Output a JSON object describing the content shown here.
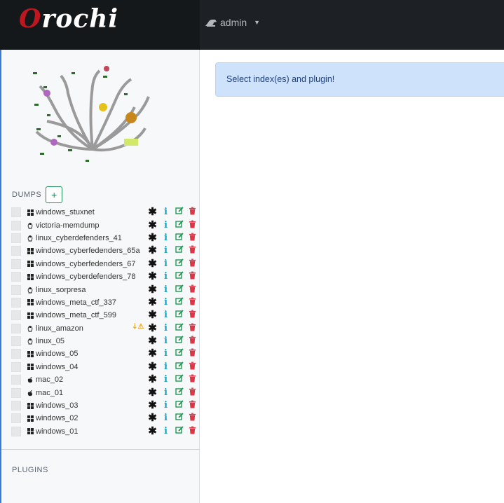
{
  "brand": {
    "first": "O",
    "rest": "rochi"
  },
  "user_menu": {
    "label": "admin",
    "icon": "user-icon"
  },
  "dumps": {
    "title": "DUMPS",
    "add_label": "+",
    "items": [
      {
        "name": "windows_stuxnet",
        "os": "windows"
      },
      {
        "name": "victoria-memdump",
        "os": "linux"
      },
      {
        "name": "linux_cyberdefenders_41",
        "os": "linux"
      },
      {
        "name": "windows_cyberfedenders_65a",
        "os": "windows"
      },
      {
        "name": "windows_cyberfedenders_67",
        "os": "windows"
      },
      {
        "name": "windows_cyberdefenders_78",
        "os": "windows"
      },
      {
        "name": "linux_sorpresa",
        "os": "linux"
      },
      {
        "name": "windows_meta_ctf_337",
        "os": "windows"
      },
      {
        "name": "windows_meta_ctf_599",
        "os": "windows"
      },
      {
        "name": "linux_amazon",
        "os": "linux",
        "warning": true
      },
      {
        "name": "linux_05",
        "os": "linux"
      },
      {
        "name": "windows_05",
        "os": "windows"
      },
      {
        "name": "windows_04",
        "os": "windows"
      },
      {
        "name": "mac_02",
        "os": "mac"
      },
      {
        "name": "mac_01",
        "os": "mac"
      },
      {
        "name": "windows_03",
        "os": "windows"
      },
      {
        "name": "windows_02",
        "os": "windows"
      },
      {
        "name": "windows_01",
        "os": "windows"
      }
    ]
  },
  "plugins": {
    "title": "PLUGINS"
  },
  "alert": {
    "text": "Select index(es) and plugin!"
  },
  "colors": {
    "info": "#12a5c4",
    "edit": "#1e9a52",
    "delete": "#dc3545",
    "warning": "#f0a81a"
  }
}
